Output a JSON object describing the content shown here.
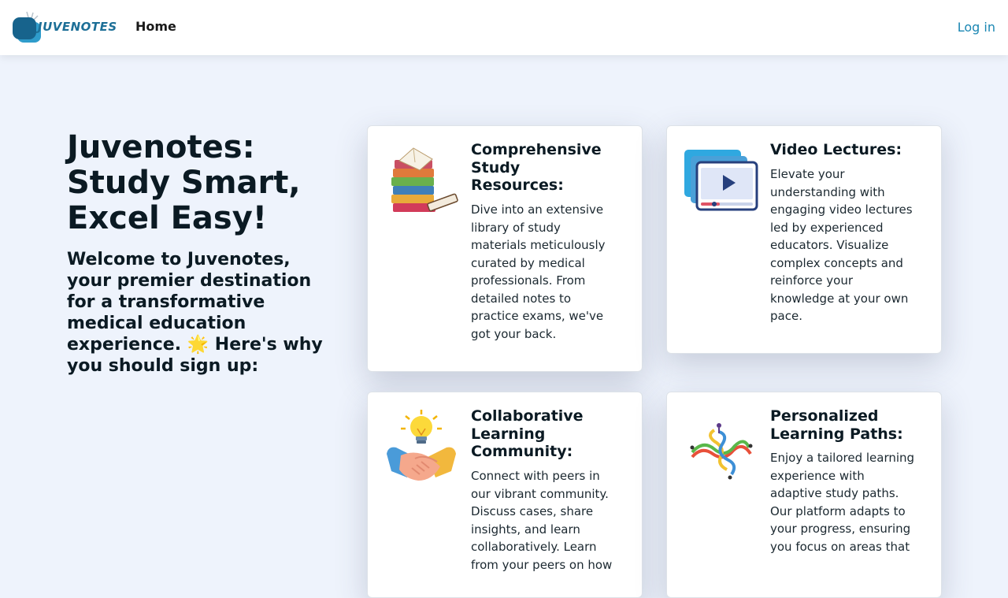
{
  "header": {
    "logo_text": "JUVENOTES",
    "nav_home": "Home",
    "login": "Log in"
  },
  "hero": {
    "title": "Juvenotes: Study Smart, Excel Easy!",
    "subtitle": "Welcome to Juvenotes, your premier destination for a transformative medical education experience. 🌟 Here's why you should sign up:"
  },
  "features": [
    {
      "title": "Comprehensive Study Resources:",
      "body": "Dive into an extensive library of study materials meticulously curated by medical professionals. From detailed notes to practice exams, we've got your back.",
      "icon": "books-icon"
    },
    {
      "title": "Video Lectures:",
      "body": "Elevate your understanding with engaging video lectures led by experienced educators. Visualize complex concepts and reinforce your knowledge at your own pace.",
      "icon": "video-player-icon"
    },
    {
      "title": "Collaborative Learning Community:",
      "body": "Connect with peers in our vibrant community. Discuss cases, share insights, and learn collaboratively. Learn from your peers on how",
      "icon": "handshake-lightbulb-icon"
    },
    {
      "title": "Personalized Learning Paths:",
      "body": "Enjoy a tailored learning experience with adaptive study paths. Our platform adapts to your progress, ensuring you focus on areas that",
      "icon": "learning-paths-icon"
    }
  ],
  "colors": {
    "background": "#eef3fc",
    "accent": "#1b87b3",
    "heading": "#0b1a23"
  }
}
